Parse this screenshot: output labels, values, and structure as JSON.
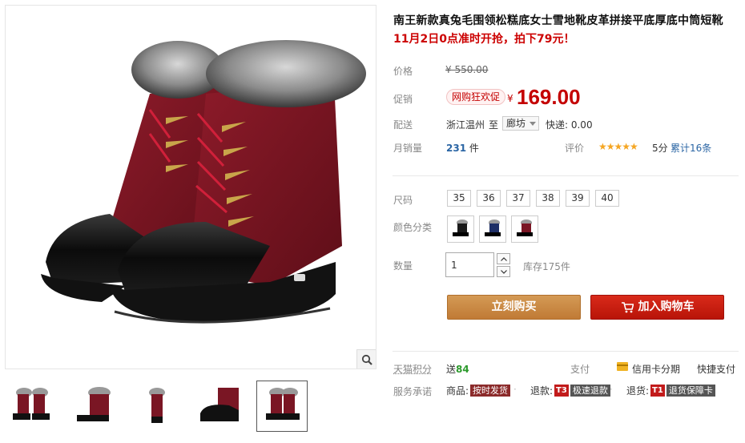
{
  "product": {
    "title": "南王新款真兔毛围领松糕底女士雪地靴皮革拼接平底厚底中筒短靴",
    "promo_notice": "11月2日0点准时开抢，拍下79元！"
  },
  "price": {
    "label": "价格",
    "original": "¥ 550.00",
    "promo_label": "促销",
    "promo_tag": "网购狂欢促",
    "currency": "¥",
    "current": "169.00"
  },
  "shipping": {
    "label": "配送",
    "from": "浙江温州",
    "to_word": "至",
    "destination": "廊坊",
    "fee": "快递: 0.00"
  },
  "sales": {
    "label": "月销量",
    "count": "231",
    "unit": "件",
    "rating_label": "评价",
    "stars": "★★★★★",
    "score": "5分",
    "reviews": "累计16条"
  },
  "sku": {
    "size_label": "尺码",
    "sizes": [
      "35",
      "36",
      "37",
      "38",
      "39",
      "40"
    ],
    "color_label": "颜色分类",
    "colors": [
      "black",
      "navy",
      "wine"
    ]
  },
  "quantity": {
    "label": "数量",
    "value": "1",
    "stock": "库存175件"
  },
  "actions": {
    "buy_now": "立刻购买",
    "add_to_cart": "加入购物车"
  },
  "extras": {
    "tmall_points_label": "天猫积分",
    "points_prefix": "送",
    "points_value": "84",
    "pay_label": "支付",
    "installment": "信用卡分期",
    "quick_pay": "快捷支付",
    "service_label": "服务承诺",
    "service_goods_prefix": "商品:",
    "service_goods_tag": "按时发货",
    "service_refund_prefix": "退款:",
    "service_refund_badge": "T3",
    "service_refund_tag": "极速退款",
    "service_return_prefix": "退货:",
    "service_return_badge": "T1",
    "service_return_tag": "退货保障卡"
  },
  "colors_theme": {
    "price_red": "#c40000",
    "buy_brown": "#c98a45",
    "cart_red": "#c8200f",
    "link_blue": "#2a65a4"
  }
}
